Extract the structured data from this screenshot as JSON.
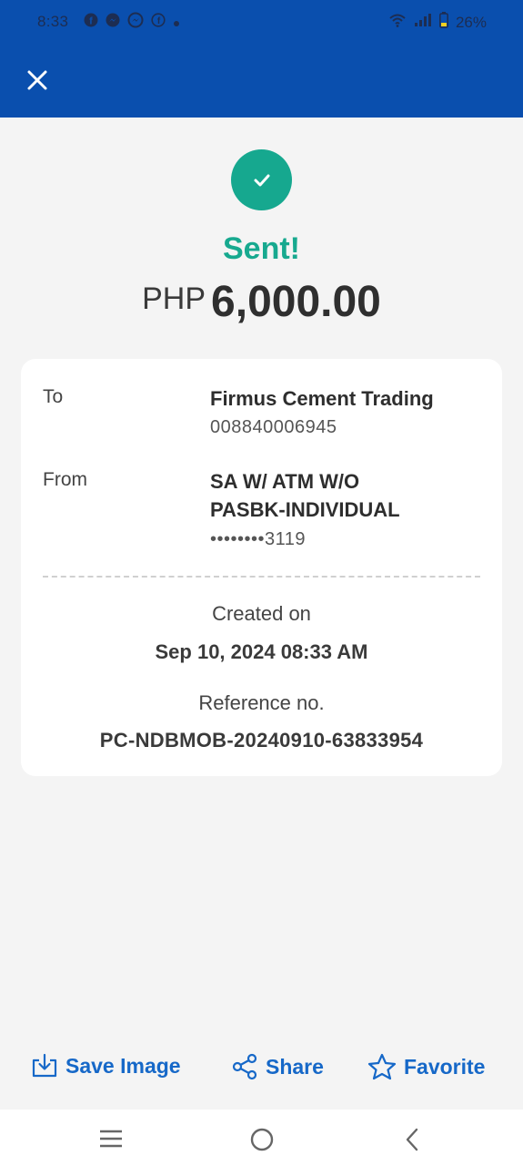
{
  "status_bar": {
    "time": "8:33",
    "battery": "26%",
    "notification_icons": [
      "facebook-icon",
      "messenger-icon",
      "messenger-outline-icon",
      "facebook-icon",
      "dot-icon"
    ]
  },
  "header": {
    "bg_color": "#0a4fae"
  },
  "receipt": {
    "status": "Sent!",
    "currency": "PHP",
    "amount": "6,000.00",
    "to_label": "To",
    "to_name": "Firmus Cement Trading",
    "to_account": "008840006945",
    "from_label": "From",
    "from_name_line1": "SA W/ ATM W/O",
    "from_name_line2": "PASBK-INDIVIDUAL",
    "from_account": "••••••••3119",
    "created_label": "Created on",
    "created_value": "Sep 10, 2024 08:33 AM",
    "reference_label": "Reference no.",
    "reference_value": "PC-NDBMOB-20240910-63833954"
  },
  "actions": {
    "save_image": "Save Image",
    "share": "Share",
    "favorite": "Favorite"
  },
  "colors": {
    "accent_green": "#16a88f",
    "link_blue": "#1668c8"
  }
}
